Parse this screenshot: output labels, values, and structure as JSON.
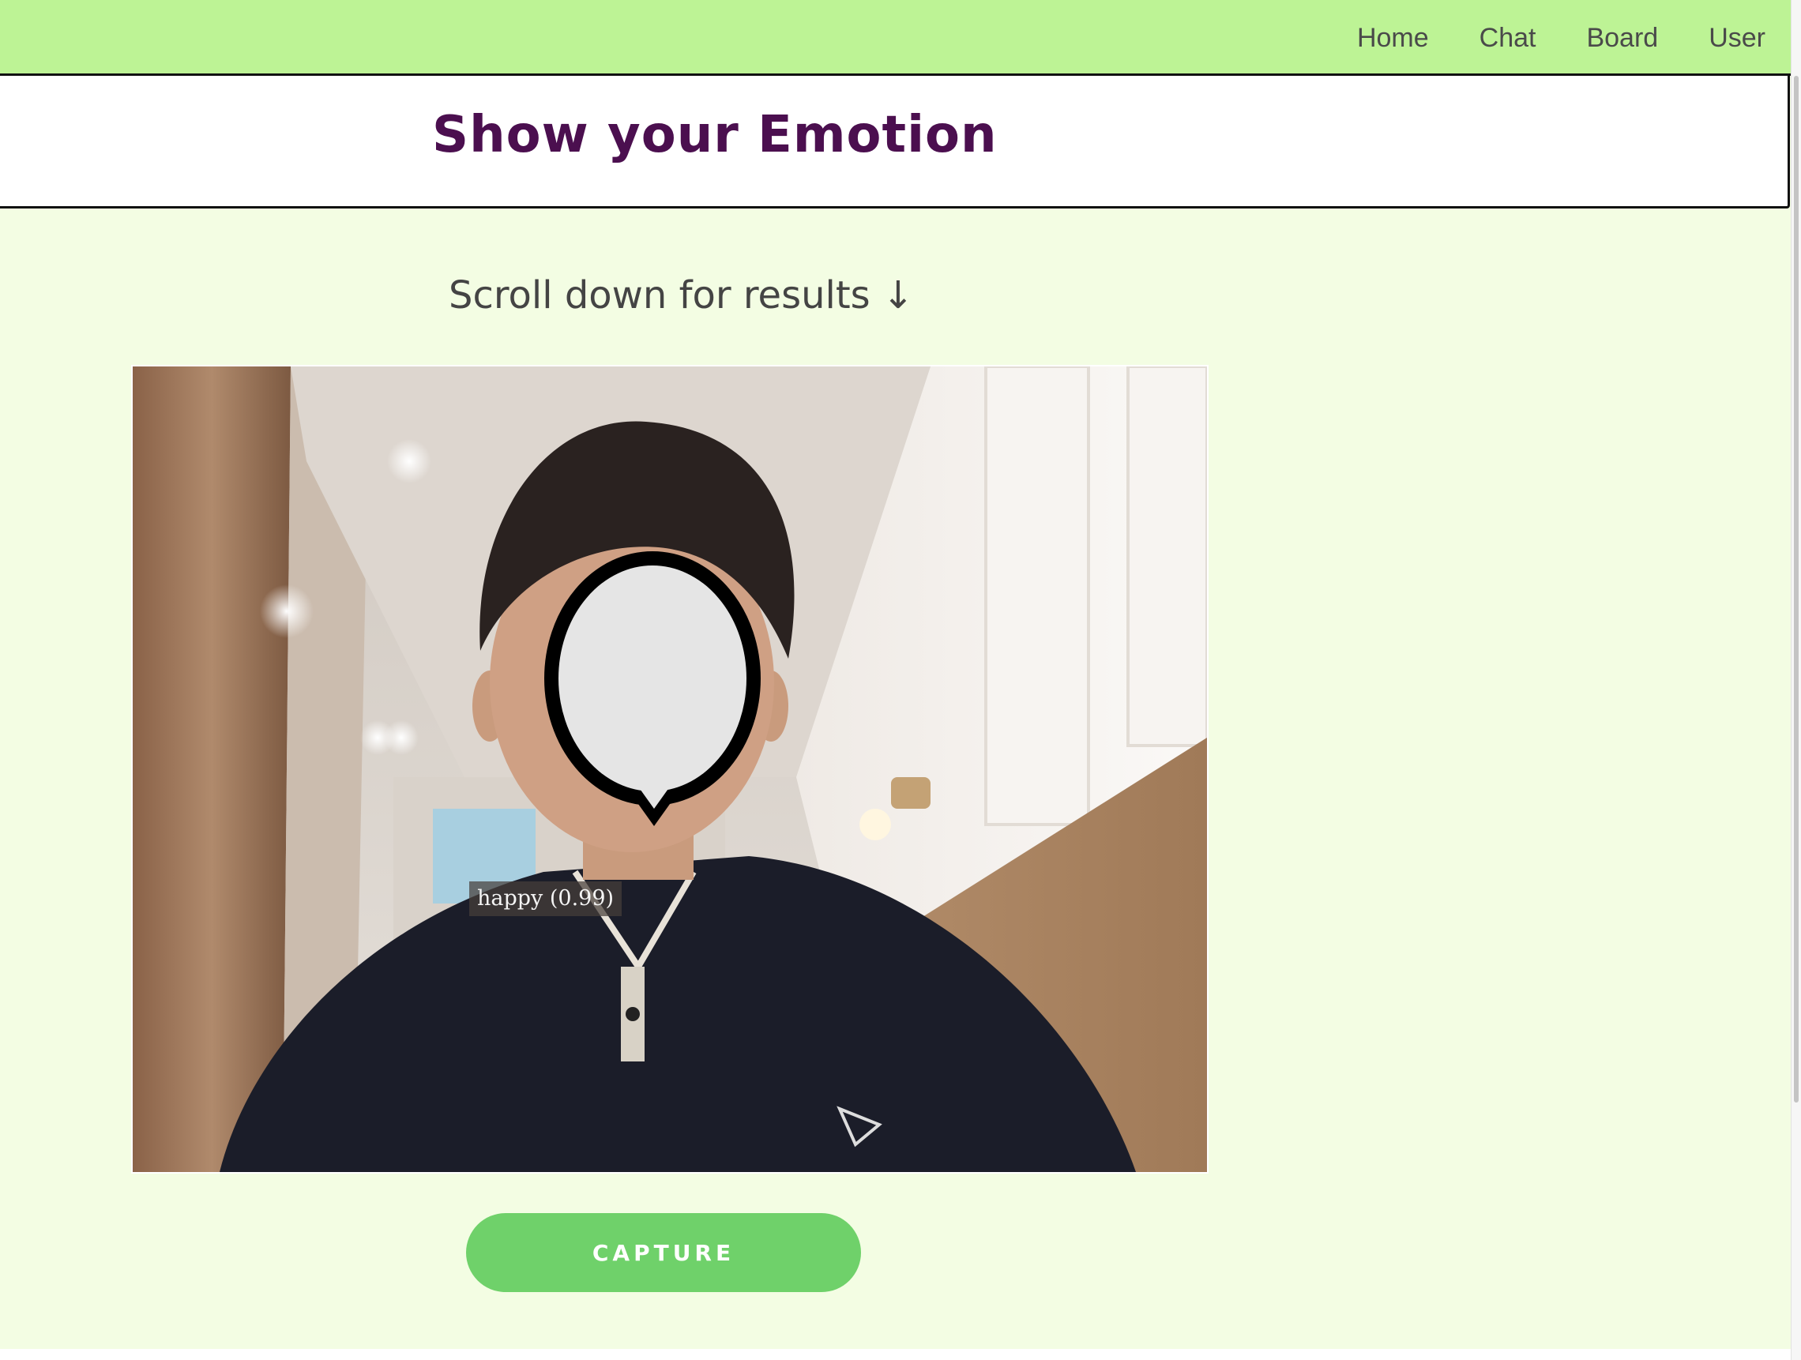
{
  "nav": {
    "items": [
      {
        "label": "Home"
      },
      {
        "label": "Chat"
      },
      {
        "label": "Board"
      },
      {
        "label": "User"
      }
    ]
  },
  "header": {
    "title": "Show your Emotion"
  },
  "main": {
    "scroll_hint": "Scroll down for results ↓",
    "emotion_label": "happy (0.99)",
    "capture_label": "CAPTURE"
  },
  "colors": {
    "nav_bg": "#bdf395",
    "page_bg": "#f3fde3",
    "title": "#4b0f4f",
    "button": "#6fd16a"
  }
}
